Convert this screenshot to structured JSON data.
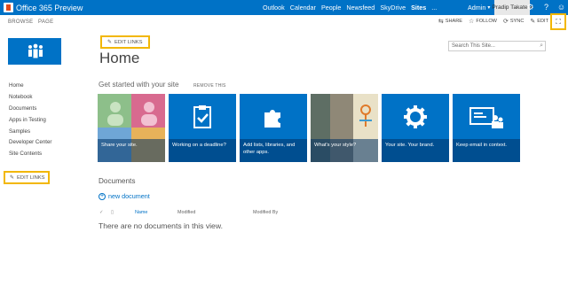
{
  "suite_bar": {
    "brand": "Office 365 Preview",
    "links": [
      "Outlook",
      "Calendar",
      "People",
      "Newsfeed",
      "SkyDrive",
      "Sites",
      "..."
    ],
    "active_link": "Sites",
    "admin_label": "Admin",
    "user_name": "Pradip Takate",
    "colors": {
      "bar": "#0072c6",
      "highlight": "#f2b705"
    }
  },
  "ribbon": {
    "tabs": [
      "BROWSE",
      "PAGE"
    ],
    "actions": [
      {
        "label": "SHARE",
        "icon": "share-icon"
      },
      {
        "label": "FOLLOW",
        "icon": "star-icon"
      },
      {
        "label": "SYNC",
        "icon": "sync-icon"
      },
      {
        "label": "EDIT",
        "icon": "pencil-icon"
      }
    ]
  },
  "header": {
    "edit_links": "EDIT LINKS",
    "title": "Home",
    "search_placeholder": "Search This Site..."
  },
  "left_nav": {
    "items": [
      "Home",
      "Notebook",
      "Documents",
      "Apps in Testing",
      "Samples",
      "Developer Center",
      "Site Contents"
    ],
    "edit_links": "EDIT LINKS"
  },
  "get_started": {
    "title": "Get started with your site",
    "remove": "REMOVE THIS",
    "tiles": [
      {
        "label": "Share your site.",
        "icon": "share-people-icon"
      },
      {
        "label": "Working on a deadline?",
        "icon": "clipboard-check-icon"
      },
      {
        "label": "Add lists, libraries, and other apps.",
        "icon": "puzzle-icon"
      },
      {
        "label": "What's your style?",
        "icon": "style-photo-icon"
      },
      {
        "label": "Your site. Your brand.",
        "icon": "gear-icon"
      },
      {
        "label": "Keep email in context.",
        "icon": "email-people-icon"
      }
    ]
  },
  "documents": {
    "title": "Documents",
    "new_document": "new document",
    "columns": [
      "Name",
      "Modified",
      "Modified By"
    ],
    "empty_message": "There are no documents in this view."
  }
}
